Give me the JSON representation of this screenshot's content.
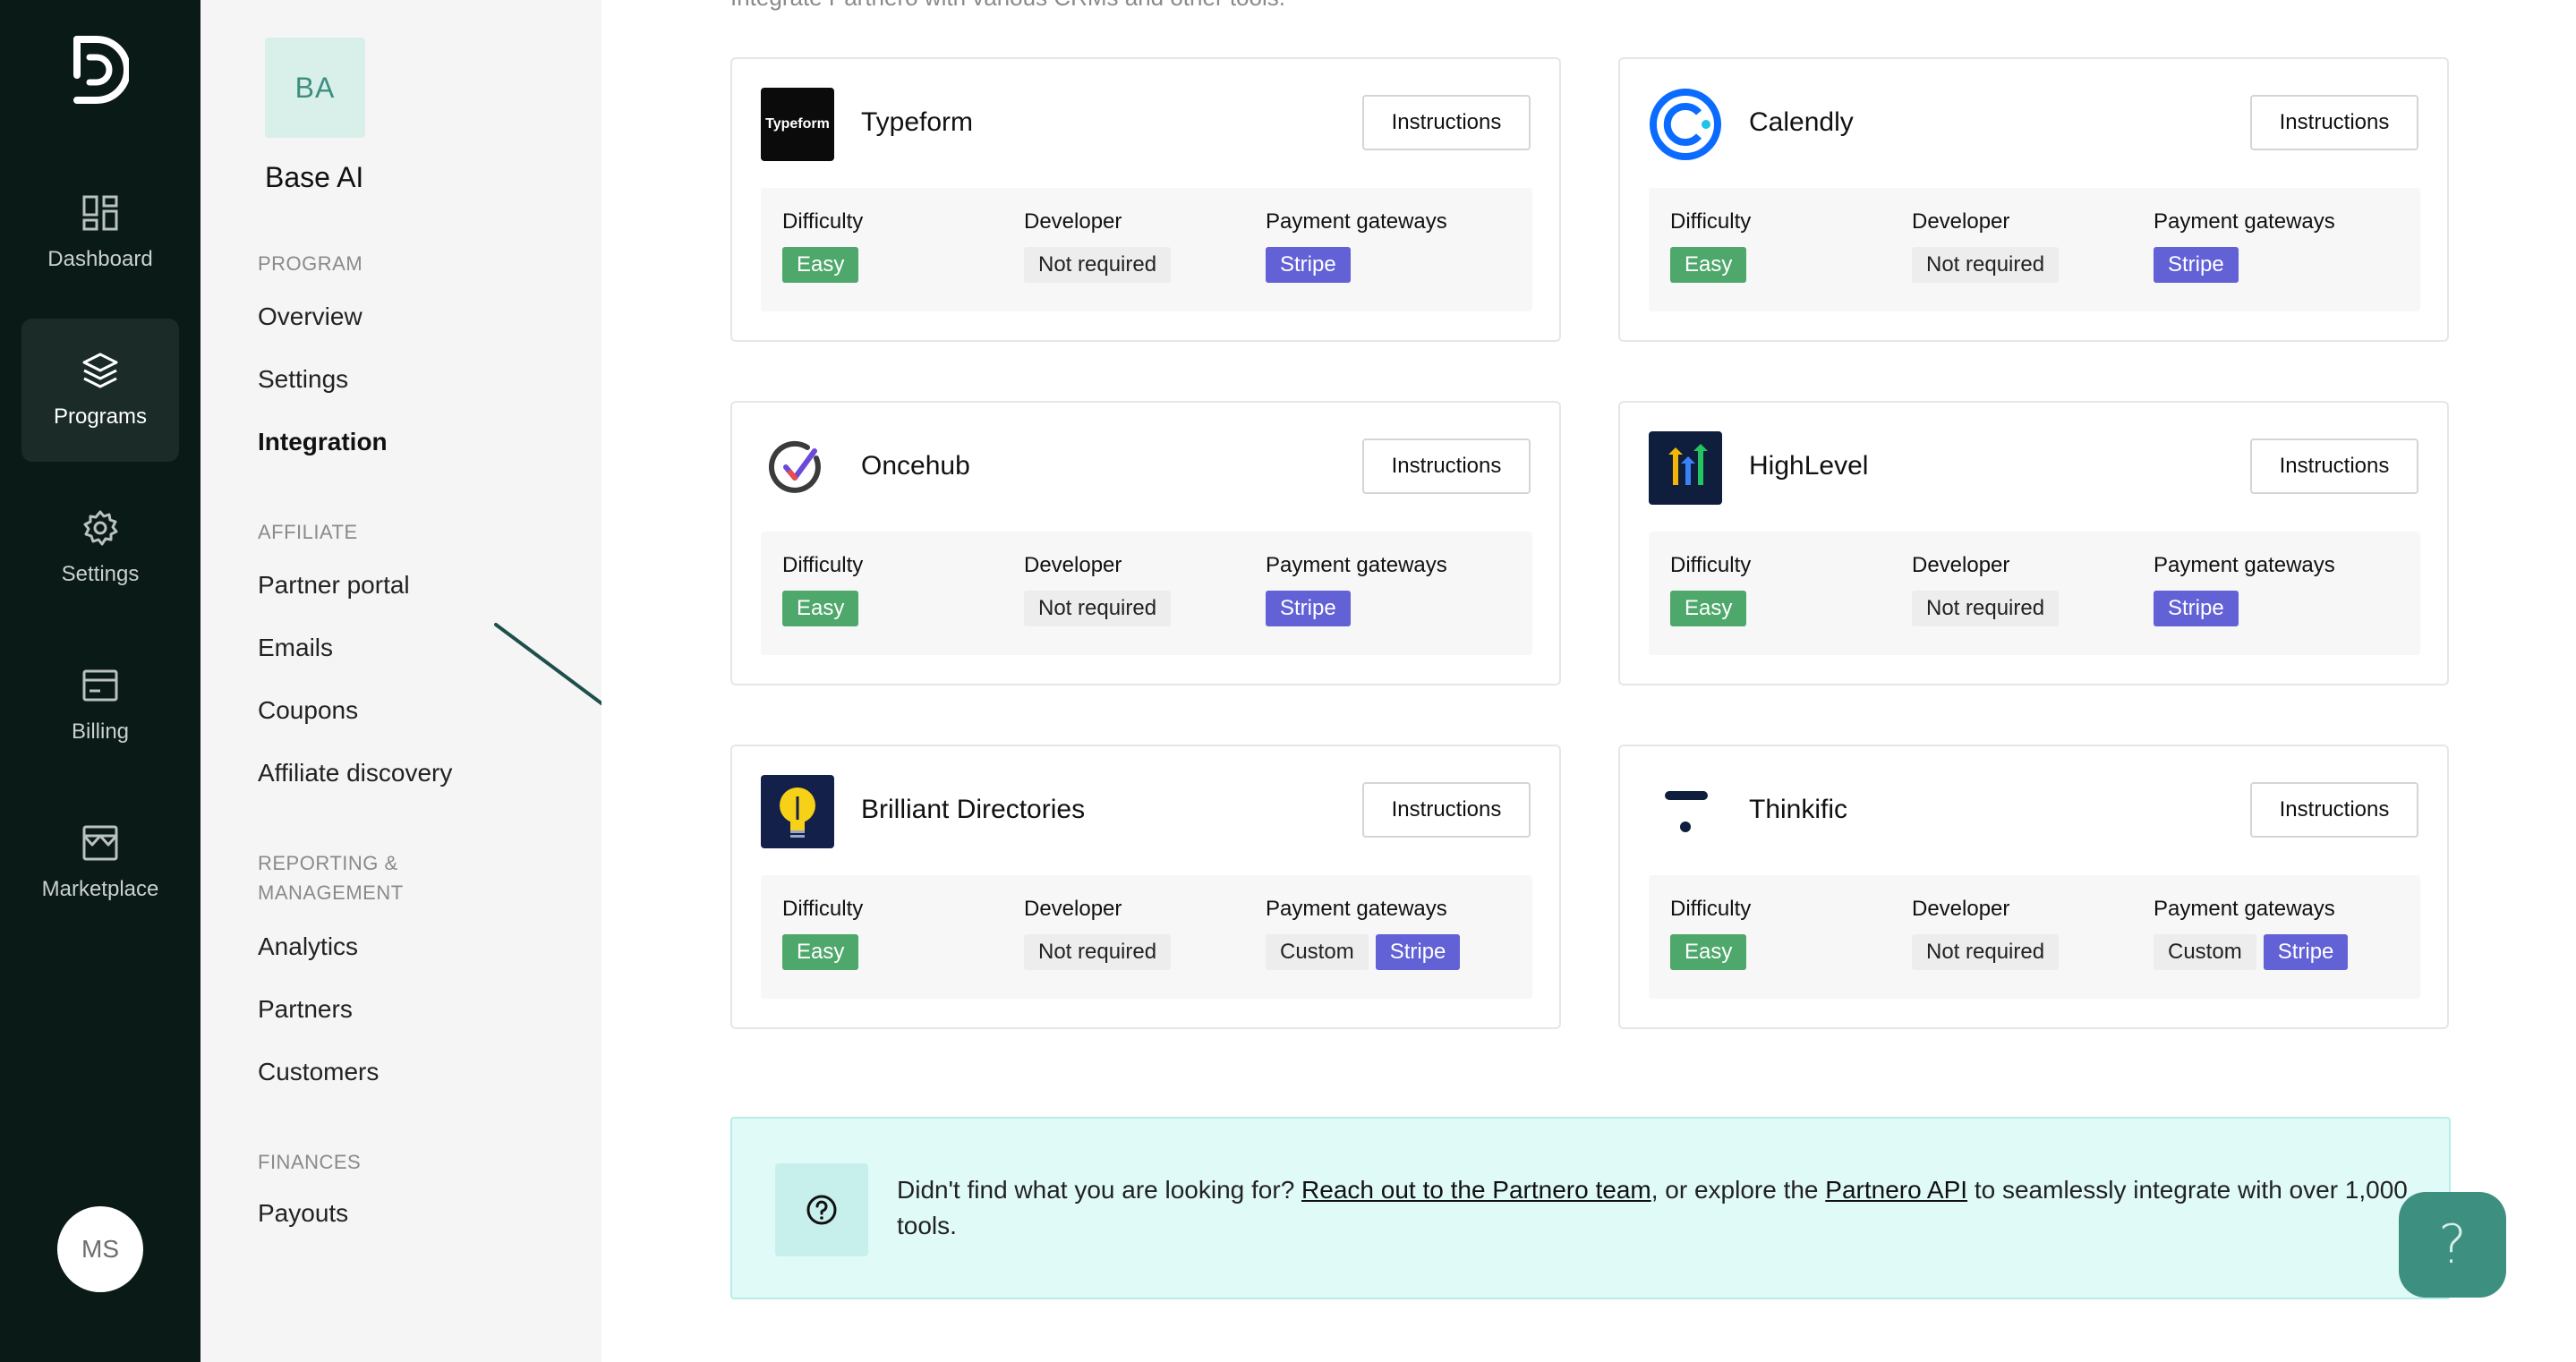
{
  "rail": {
    "items": [
      {
        "label": "Dashboard",
        "icon": "dashboard-icon"
      },
      {
        "label": "Programs",
        "icon": "layers-icon"
      },
      {
        "label": "Settings",
        "icon": "gear-icon"
      },
      {
        "label": "Billing",
        "icon": "billing-icon"
      },
      {
        "label": "Marketplace",
        "icon": "store-icon"
      }
    ],
    "active": "Programs",
    "avatar": "MS"
  },
  "program": {
    "badge": "BA",
    "name": "Base AI"
  },
  "nav": {
    "program_header": "PROGRAM",
    "overview": "Overview",
    "settings": "Settings",
    "integration": "Integration",
    "affiliate_header": "AFFILIATE",
    "partner_portal": "Partner portal",
    "emails": "Emails",
    "coupons": "Coupons",
    "affiliate_discovery": "Affiliate discovery",
    "reporting_header_1": "REPORTING &",
    "reporting_header_2": "MANAGEMENT",
    "analytics": "Analytics",
    "partners": "Partners",
    "customers": "Customers",
    "finances_header": "FINANCES",
    "payouts": "Payouts",
    "active": "Integration"
  },
  "main": {
    "intro": "Integrate Partnero with various CRMs and other tools.",
    "labels": {
      "difficulty": "Difficulty",
      "developer": "Developer",
      "payment_gateways": "Payment gateways",
      "instructions": "Instructions"
    },
    "integrations": [
      {
        "name": "Typeform",
        "logo_text": "Typeform",
        "difficulty": "Easy",
        "developer": "Not required",
        "gateways": [
          "Stripe"
        ]
      },
      {
        "name": "Calendly",
        "difficulty": "Easy",
        "developer": "Not required",
        "gateways": [
          "Stripe"
        ]
      },
      {
        "name": "Oncehub",
        "difficulty": "Easy",
        "developer": "Not required",
        "gateways": [
          "Stripe"
        ]
      },
      {
        "name": "HighLevel",
        "difficulty": "Easy",
        "developer": "Not required",
        "gateways": [
          "Stripe"
        ]
      },
      {
        "name": "Brilliant Directories",
        "difficulty": "Easy",
        "developer": "Not required",
        "gateways": [
          "Custom",
          "Stripe"
        ]
      },
      {
        "name": "Thinkific",
        "difficulty": "Easy",
        "developer": "Not required",
        "gateways": [
          "Custom",
          "Stripe"
        ]
      }
    ],
    "help": {
      "prefix": "Didn't find what you are looking for? ",
      "link1": "Reach out to the Partnero team",
      "middle": ", or explore the ",
      "link2": "Partnero API",
      "suffix": " to seamlessly integrate with over 1,000 tools."
    },
    "help_fab": "?"
  },
  "colors": {
    "rail_bg": "#0a1a17",
    "subnav_bg": "#f5f5f5",
    "easy_green": "#4fa86b",
    "stripe_purple": "#6261d6",
    "help_bg": "#e0faf8",
    "fab_teal": "#3d8f7f",
    "arrow": "#1f4f4a"
  }
}
